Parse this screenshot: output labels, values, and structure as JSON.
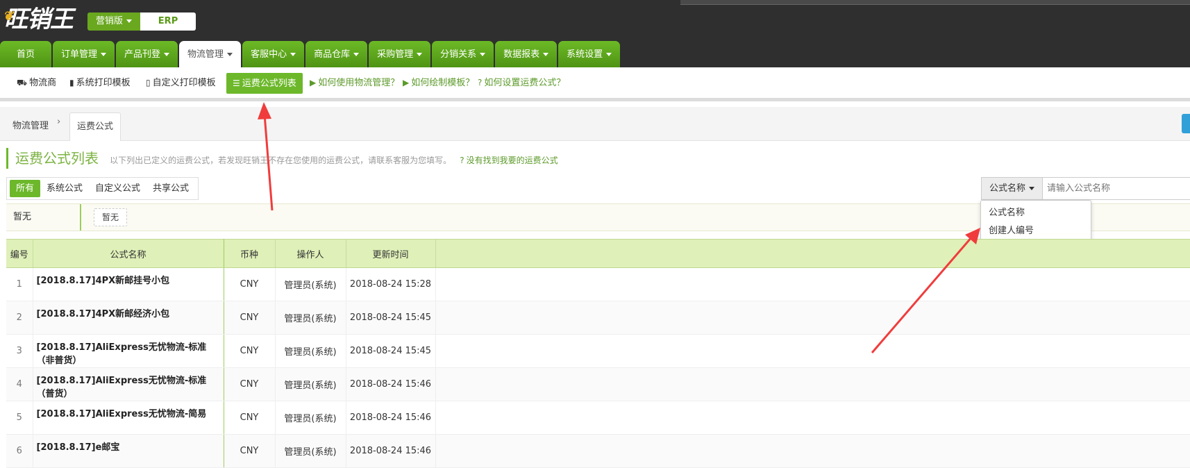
{
  "header": {
    "logo_text": "旺销王",
    "edition": "营销版",
    "erp": "ERP"
  },
  "main_nav": [
    {
      "label": "首页",
      "dropdown": false,
      "active": false
    },
    {
      "label": "订单管理",
      "dropdown": true,
      "active": false
    },
    {
      "label": "产品刊登",
      "dropdown": true,
      "active": false
    },
    {
      "label": "物流管理",
      "dropdown": true,
      "active": true
    },
    {
      "label": "客服中心",
      "dropdown": true,
      "active": false
    },
    {
      "label": "商品仓库",
      "dropdown": true,
      "active": false
    },
    {
      "label": "采购管理",
      "dropdown": true,
      "active": false
    },
    {
      "label": "分销关系",
      "dropdown": true,
      "active": false
    },
    {
      "label": "数据报表",
      "dropdown": true,
      "active": false
    },
    {
      "label": "系统设置",
      "dropdown": true,
      "active": false
    }
  ],
  "sub_nav": {
    "carrier": "物流商",
    "system_template": "系统打印模板",
    "custom_template": "自定义打印模板",
    "formula_list": "运费公式列表",
    "help_logistics": "如何使用物流管理？",
    "help_template": "如何绘制模板？",
    "help_formula": "如何设置运费公式？"
  },
  "breadcrumb": {
    "root": "物流管理",
    "separator": "›",
    "current": "运费公式"
  },
  "page": {
    "title": "运费公式列表",
    "description": "以下列出已定义的运费公式，若发现旺销王不存在您使用的运费公式，请联系客服为您填写。",
    "question_link": "没有找到我要的运费公式"
  },
  "filters": [
    "所有",
    "系统公式",
    "自定义公式",
    "共享公式"
  ],
  "search": {
    "field": "公式名称",
    "placeholder": "请输入公式名称",
    "options": [
      "公式名称",
      "创建人编号"
    ]
  },
  "tag_row": {
    "label": "暂无",
    "chip": "暂无"
  },
  "table": {
    "columns": [
      "编号",
      "公式名称",
      "币种",
      "操作人",
      "更新时间"
    ],
    "rows": [
      {
        "no": "1",
        "name": "[2018.8.17]4PX新邮挂号小包",
        "currency": "CNY",
        "operator": "管理员(系统)",
        "updated": "2018-08-24 15:28"
      },
      {
        "no": "2",
        "name": "[2018.8.17]4PX新邮经济小包",
        "currency": "CNY",
        "operator": "管理员(系统)",
        "updated": "2018-08-24 15:45"
      },
      {
        "no": "3",
        "name": "[2018.8.17]AliExpress无忧物流-标准（非普货）",
        "currency": "CNY",
        "operator": "管理员(系统)",
        "updated": "2018-08-24 15:45"
      },
      {
        "no": "4",
        "name": "[2018.8.17]AliExpress无忧物流-标准（普货）",
        "currency": "CNY",
        "operator": "管理员(系统)",
        "updated": "2018-08-24 15:46"
      },
      {
        "no": "5",
        "name": "[2018.8.17]AliExpress无忧物流-简易",
        "currency": "CNY",
        "operator": "管理员(系统)",
        "updated": "2018-08-24 15:46"
      },
      {
        "no": "6",
        "name": "[2018.8.17]e邮宝",
        "currency": "CNY",
        "operator": "管理员(系统)",
        "updated": "2018-08-24 15:46"
      }
    ]
  },
  "colors": {
    "brand_green": "#6cb82a",
    "header_bg": "#2f2f2f",
    "annotation_red": "#f03c3c"
  }
}
